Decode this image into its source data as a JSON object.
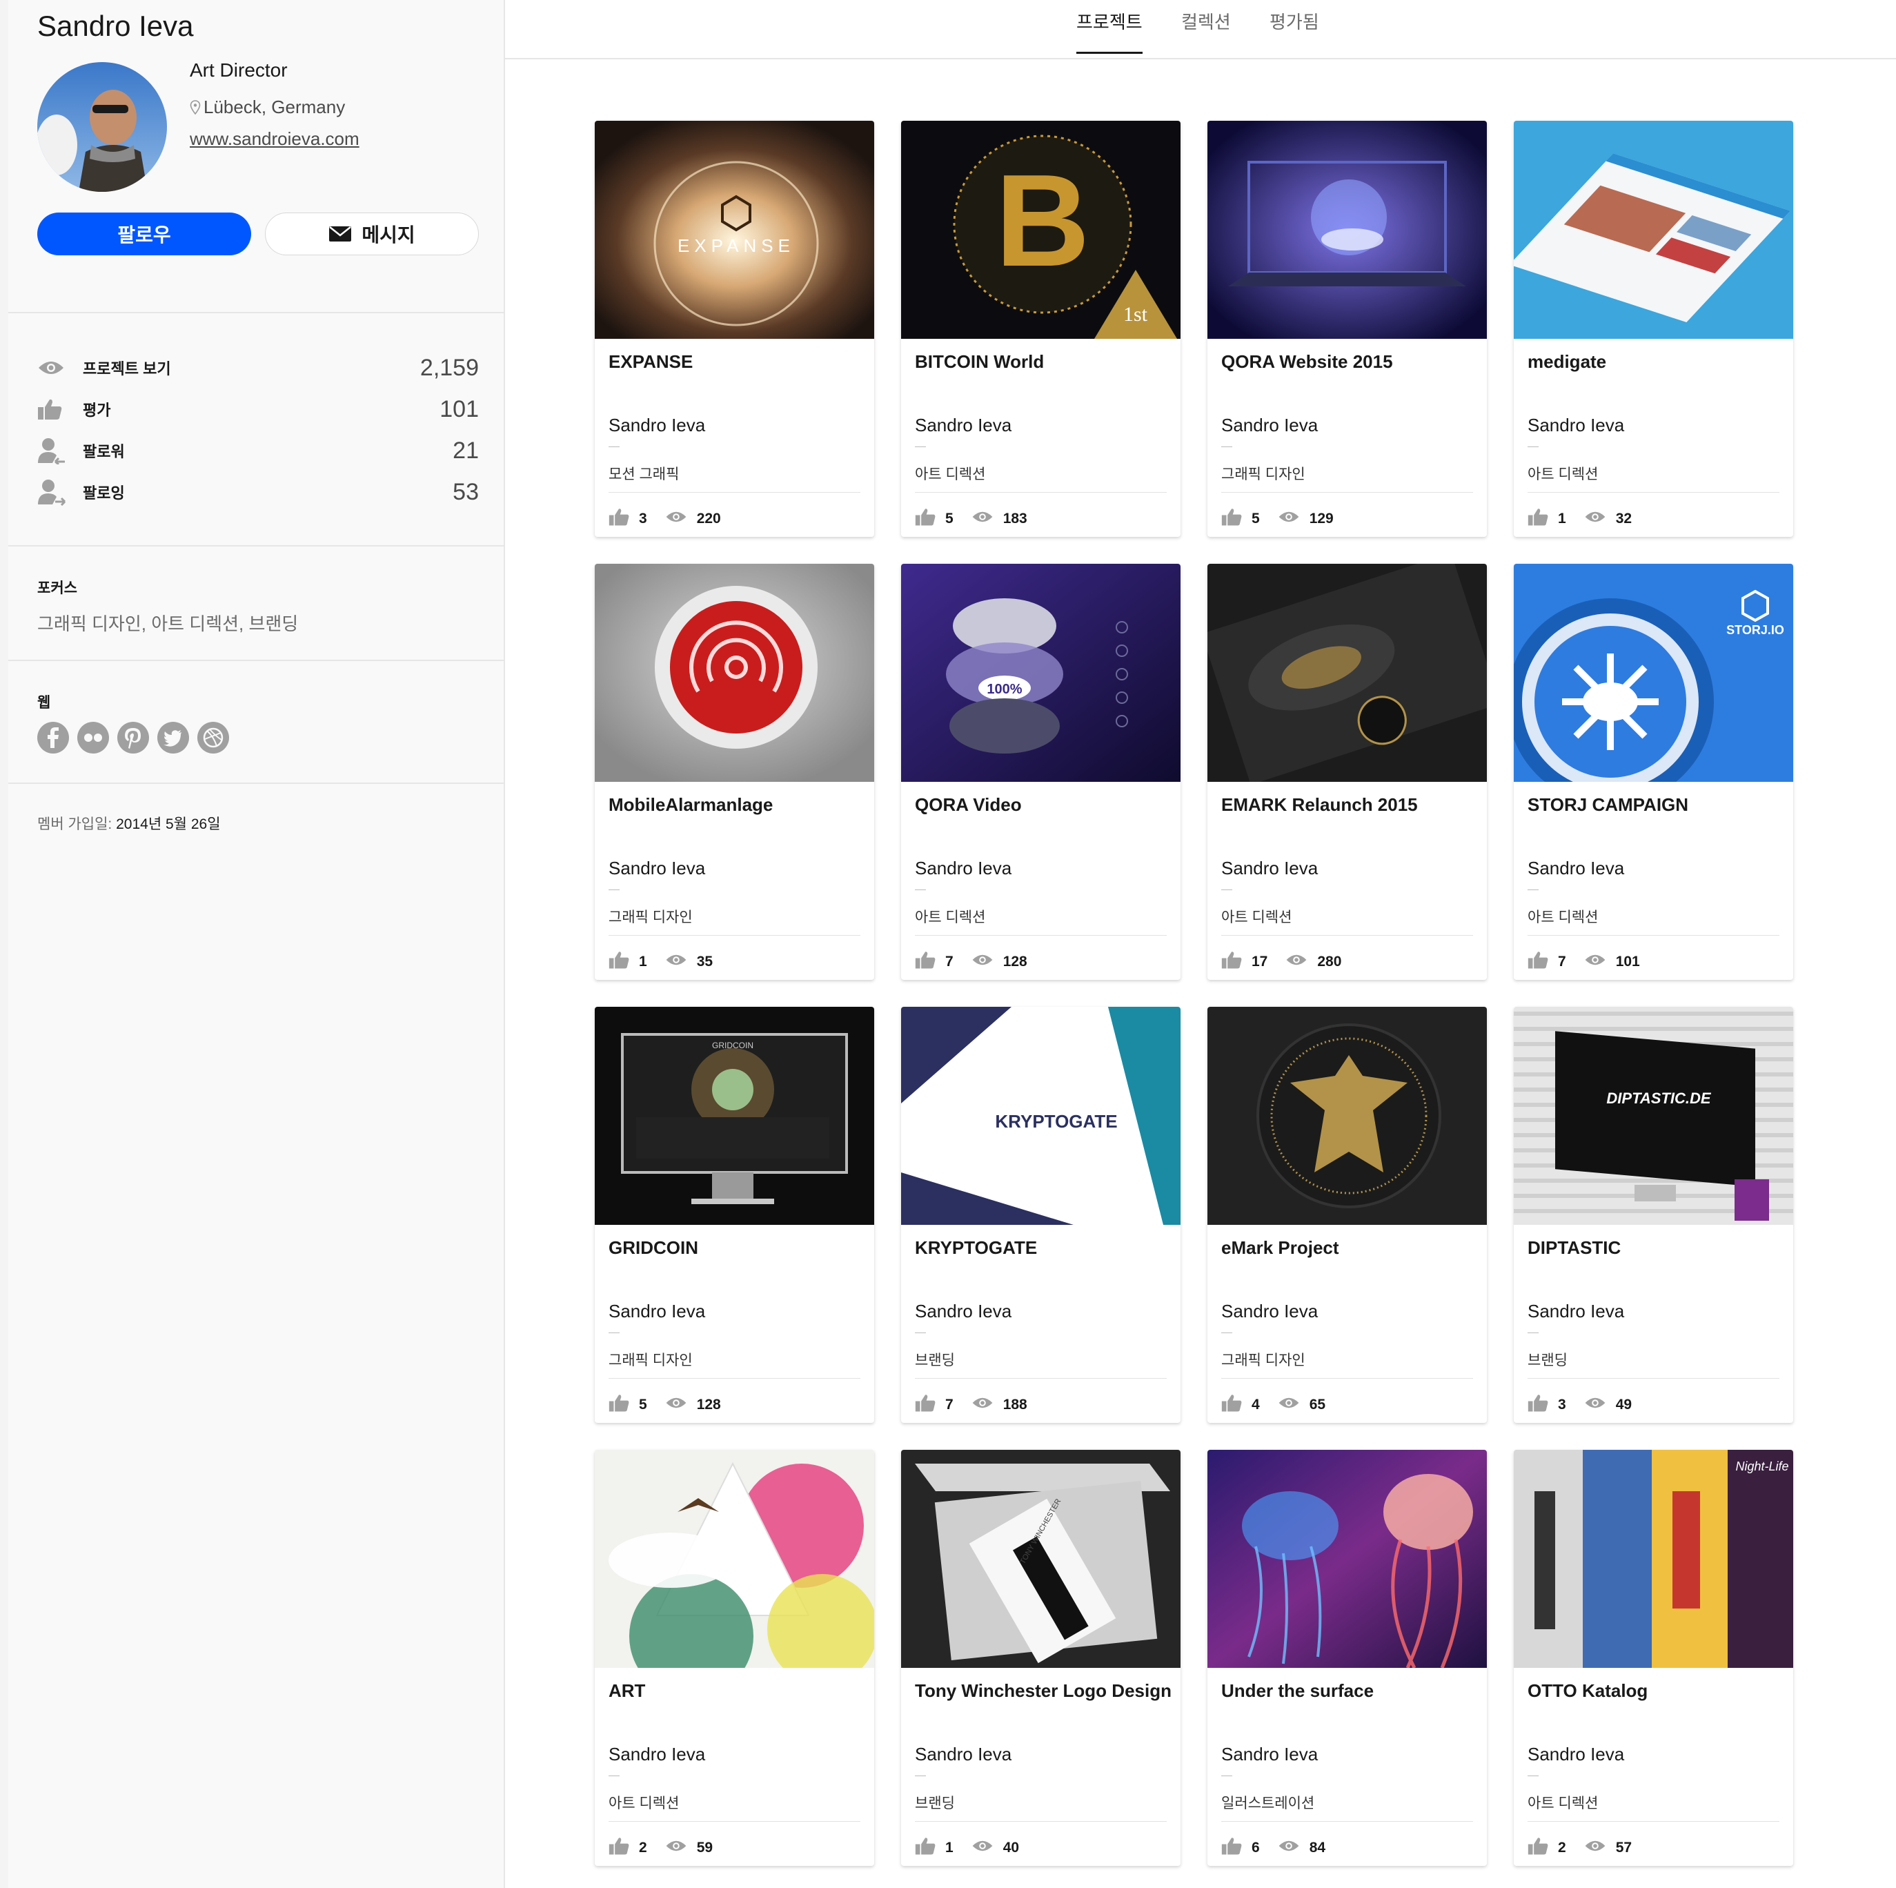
{
  "profile": {
    "name": "Sandro Ieva",
    "occupation": "Art Director",
    "location": "Lübeck, Germany",
    "website": "www.sandroieva.com",
    "follow_label": "팔로우",
    "message_label": "메시지"
  },
  "stats": [
    {
      "label": "프로젝트 보기",
      "value": "2,159",
      "icon": "eye-icon"
    },
    {
      "label": "평가",
      "value": "101",
      "icon": "thumbs-up-icon"
    },
    {
      "label": "팔로워",
      "value": "21",
      "icon": "follower-icon"
    },
    {
      "label": "팔로잉",
      "value": "53",
      "icon": "following-icon"
    }
  ],
  "focus": {
    "title": "포커스",
    "value": "그래픽 디자인, 아트 디렉션, 브랜딩"
  },
  "web": {
    "title": "웹",
    "links": [
      "facebook-icon",
      "flickr-icon",
      "pinterest-icon",
      "twitter-icon",
      "dribbble-icon"
    ]
  },
  "member": {
    "label": "멤버 가입일:",
    "value": "2014년 5월 26일"
  },
  "tabs": [
    "프로젝트",
    "컬렉션",
    "평가됨"
  ],
  "projects": [
    {
      "title": "EXPANSE",
      "owner": "Sandro Ieva",
      "field": "모션 그래픽",
      "likes": "3",
      "views": "220",
      "thumb_text": "EXPANSE"
    },
    {
      "title": "BITCOIN World",
      "owner": "Sandro Ieva",
      "field": "아트 디렉션",
      "likes": "5",
      "views": "183",
      "thumb_text": "1st"
    },
    {
      "title": "QORA Website 2015",
      "owner": "Sandro Ieva",
      "field": "그래픽 디자인",
      "likes": "5",
      "views": "129",
      "thumb_text": ""
    },
    {
      "title": "medigate",
      "owner": "Sandro Ieva",
      "field": "아트 디렉션",
      "likes": "1",
      "views": "32",
      "thumb_text": ""
    },
    {
      "title": "MobileAlarmanlage",
      "owner": "Sandro Ieva",
      "field": "그래픽 디자인",
      "likes": "1",
      "views": "35",
      "thumb_text": ""
    },
    {
      "title": "QORA Video",
      "owner": "Sandro Ieva",
      "field": "아트 디렉션",
      "likes": "7",
      "views": "128",
      "thumb_text": "100%"
    },
    {
      "title": "EMARK Relaunch 2015",
      "owner": "Sandro Ieva",
      "field": "아트 디렉션",
      "likes": "17",
      "views": "280",
      "thumb_text": ""
    },
    {
      "title": "STORJ CAMPAIGN",
      "owner": "Sandro Ieva",
      "field": "아트 디렉션",
      "likes": "7",
      "views": "101",
      "thumb_text": "STORJ.IO"
    },
    {
      "title": "GRIDCOIN",
      "owner": "Sandro Ieva",
      "field": "그래픽 디자인",
      "likes": "5",
      "views": "128",
      "thumb_text": "GRIDCOIN"
    },
    {
      "title": "KRYPTOGATE",
      "owner": "Sandro Ieva",
      "field": "브랜딩",
      "likes": "7",
      "views": "188",
      "thumb_text": "KRYPTOGATE"
    },
    {
      "title": "eMark Project",
      "owner": "Sandro Ieva",
      "field": "그래픽 디자인",
      "likes": "4",
      "views": "65",
      "thumb_text": ""
    },
    {
      "title": "DIPTASTIC",
      "owner": "Sandro Ieva",
      "field": "브랜딩",
      "likes": "3",
      "views": "49",
      "thumb_text": "DIPTASTIC.DE"
    },
    {
      "title": "ART",
      "owner": "Sandro Ieva",
      "field": "아트 디렉션",
      "likes": "2",
      "views": "59",
      "thumb_text": ""
    },
    {
      "title": "Tony Winchester Logo Design",
      "owner": "Sandro Ieva",
      "field": "브랜딩",
      "likes": "1",
      "views": "40",
      "thumb_text": "TONY WINCHESTER"
    },
    {
      "title": "Under the surface",
      "owner": "Sandro Ieva",
      "field": "일러스트레이션",
      "likes": "6",
      "views": "84",
      "thumb_text": ""
    },
    {
      "title": "OTTO Katalog",
      "owner": "Sandro Ieva",
      "field": "아트 디렉션",
      "likes": "2",
      "views": "57",
      "thumb_text": "Night-Life"
    }
  ],
  "colors": {
    "accent": "#0057ff",
    "text": "#191919",
    "muted": "#6a6a6a",
    "icon_gray": "#a0a0a0"
  }
}
